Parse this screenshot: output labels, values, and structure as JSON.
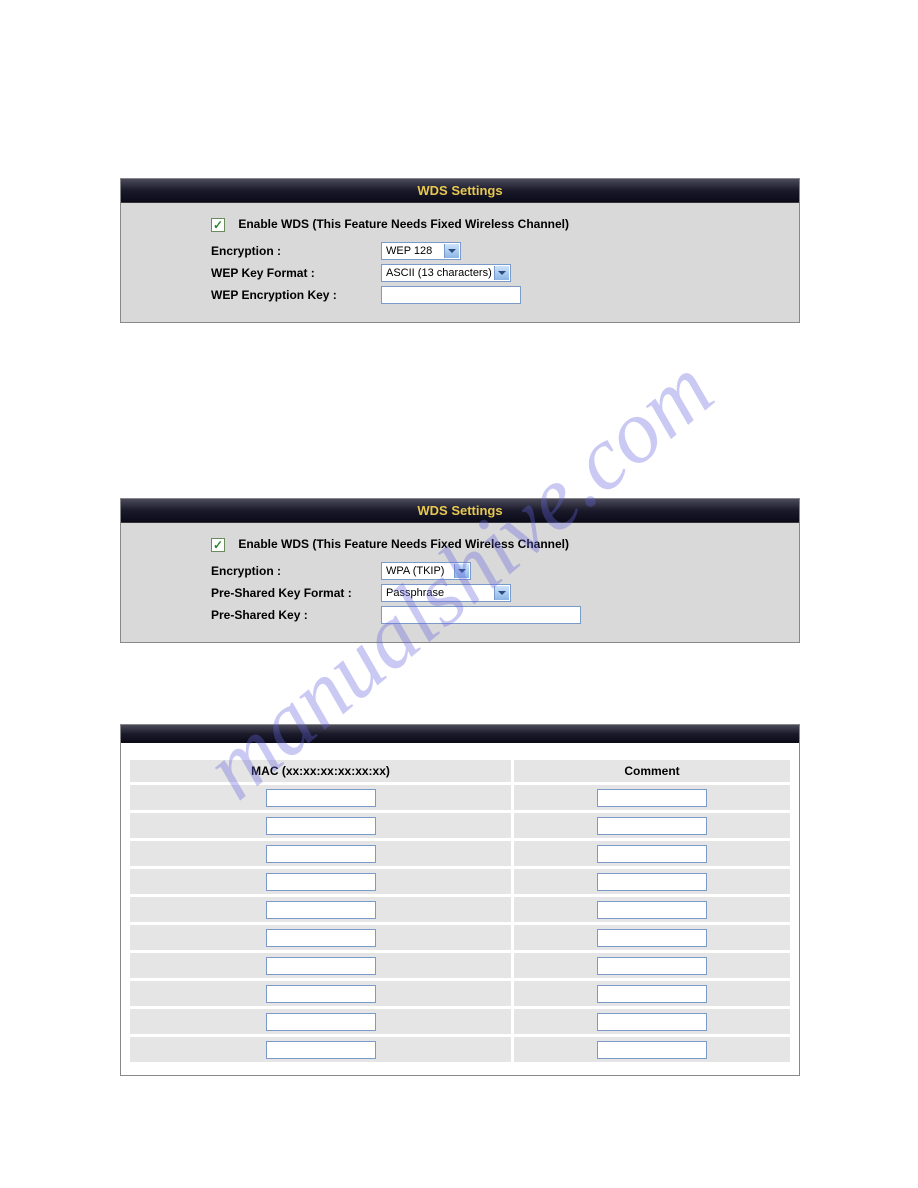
{
  "watermark": "manualshive.com",
  "panel1": {
    "title": "WDS Settings",
    "enable_checked": true,
    "enable_label": "Enable WDS (This Feature Needs Fixed Wireless Channel)",
    "encryption_label": "Encryption :",
    "encryption_value": "WEP 128",
    "keyformat_label": "WEP Key Format :",
    "keyformat_value": "ASCII (13 characters)",
    "key_label": "WEP Encryption Key :",
    "key_value": ""
  },
  "panel2": {
    "title": "WDS Settings",
    "enable_checked": true,
    "enable_label": "Enable WDS (This Feature Needs Fixed Wireless Channel)",
    "encryption_label": "Encryption :",
    "encryption_value": "WPA (TKIP)",
    "pskformat_label": "Pre-Shared Key Format :",
    "pskformat_value": "Passphrase",
    "psk_label": "Pre-Shared Key :",
    "psk_value": ""
  },
  "panel3": {
    "col_mac": "MAC (xx:xx:xx:xx:xx:xx)",
    "col_comment": "Comment",
    "rows": [
      {
        "mac": "",
        "comment": ""
      },
      {
        "mac": "",
        "comment": ""
      },
      {
        "mac": "",
        "comment": ""
      },
      {
        "mac": "",
        "comment": ""
      },
      {
        "mac": "",
        "comment": ""
      },
      {
        "mac": "",
        "comment": ""
      },
      {
        "mac": "",
        "comment": ""
      },
      {
        "mac": "",
        "comment": ""
      },
      {
        "mac": "",
        "comment": ""
      },
      {
        "mac": "",
        "comment": ""
      }
    ]
  }
}
